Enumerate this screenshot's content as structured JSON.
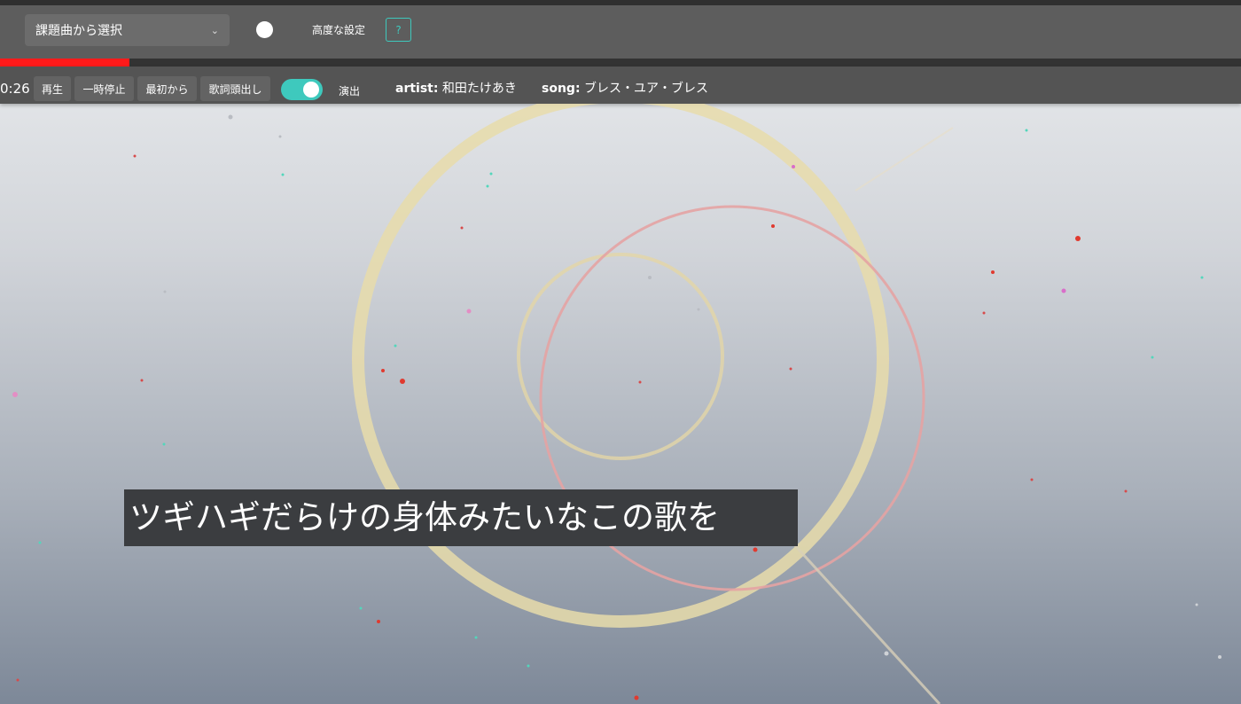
{
  "header": {
    "song_select": "課題曲から選択",
    "advanced_label": "高度な設定",
    "help_label": "?"
  },
  "playback": {
    "progress": 0.104,
    "progress_color": "#ff1a1a",
    "time": "0:26"
  },
  "controls": {
    "play": "再生",
    "pause": "一時停止",
    "restart": "最初から",
    "lyrics_cue": "歌詞頭出し",
    "effects_label": "演出",
    "effects_on": true,
    "accent_color": "#3ec9bd"
  },
  "song_info": {
    "artist_key": "artist:",
    "artist": "和田たけあき",
    "song_key": "song:",
    "song": "ブレス・ユア・ブレス"
  },
  "lyric": {
    "text": "ツギハギだらけの身体みたいなこの歌を"
  },
  "icons": {
    "select_arrow": "chevron-down-icon"
  }
}
